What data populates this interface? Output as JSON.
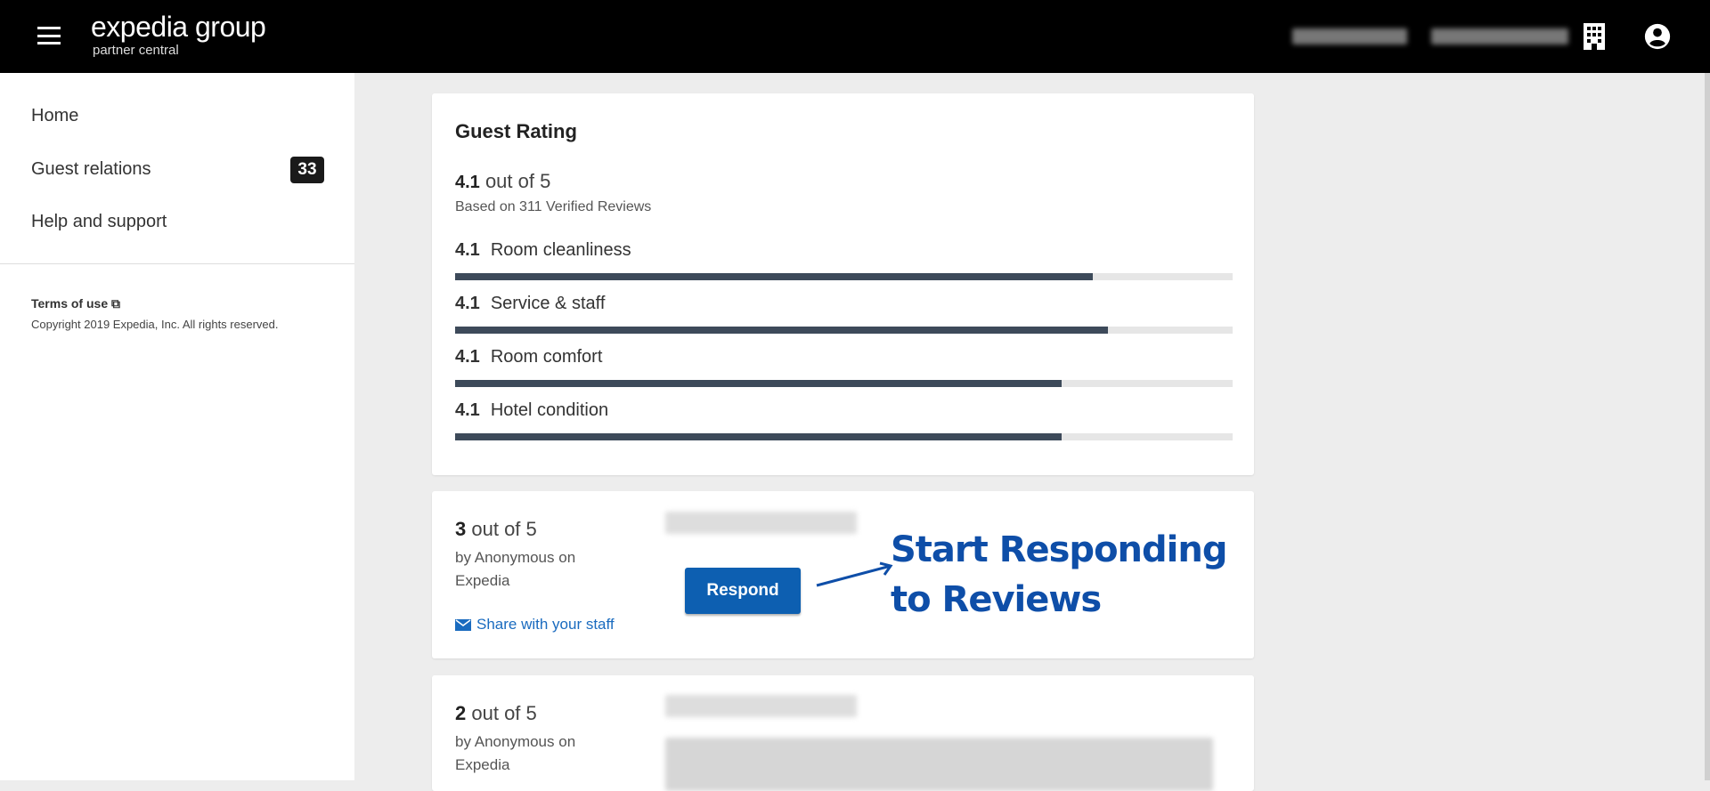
{
  "header": {
    "logo_line1": "expedia group",
    "logo_line2": "partner central",
    "icons": [
      "menu-icon",
      "building-icon",
      "account-icon"
    ]
  },
  "sidebar": {
    "items": [
      {
        "label": "Home"
      },
      {
        "label": "Guest relations",
        "badge": "33"
      },
      {
        "label": "Help and support"
      }
    ],
    "terms": "Terms of use",
    "copyright": "Copyright 2019 Expedia, Inc. All rights reserved."
  },
  "rating": {
    "title": "Guest Rating",
    "score": "4.1",
    "out_of": "out of 5",
    "based_on": "Based on 311 Verified Reviews",
    "categories": [
      {
        "score": "4.1",
        "label": "Room cleanliness",
        "fill": 0.82
      },
      {
        "score": "4.1",
        "label": "Service & staff",
        "fill": 0.84
      },
      {
        "score": "4.1",
        "label": "Room comfort",
        "fill": 0.78
      },
      {
        "score": "4.1",
        "label": "Hotel condition",
        "fill": 0.78
      }
    ]
  },
  "reviews": [
    {
      "score": "3",
      "out_of": "out of 5",
      "by": "by Anonymous on Expedia",
      "respond": "Respond",
      "share": "Share with your staff"
    },
    {
      "score": "2",
      "out_of": "out of 5",
      "by": "by Anonymous on Expedia"
    }
  ],
  "annotation": {
    "text": "Start Responding to Reviews",
    "color": "#0e4ea8"
  }
}
